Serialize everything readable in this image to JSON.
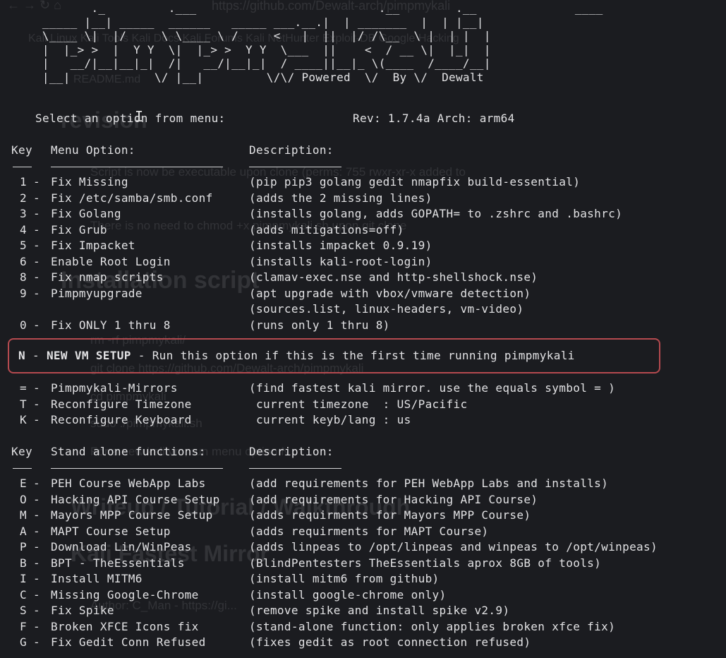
{
  "ghost": {
    "url": "https://github.com/Dewalt-arch/pimpmykali",
    "bookmarks": "Kali Linux   Kali Tools   Kali Docs   Kali Forums   Kali NetHunter   Exploit-DB   Google Hacking",
    "readme": "README.md",
    "h_revision": "revision",
    "bullet1": "Script is now be executable upon clone (perms: 755 rwxr-xr-x added to",
    "bullet2": "There is no need to chmod +x pimpmykali.sh upon git clone",
    "h_installation": "Installation script",
    "bullet3": "rm -rf pimpmykali/",
    "bullet4": "git clone https://github.com/Dewalt-arch/pimpmykali",
    "bullet5": "cd pimpmykali",
    "bullet6": "sudo ./pimpmykali.sh",
    "bullet7": "For a new kali vm, run menu option N",
    "h_writeup": "Writeup / Tutorial / Walkthrough",
    "h_fastest": "Kali Fastest Mirror",
    "bullet8": "Author: C_Man - https://gi..."
  },
  "banner": {
    "ascii": "        ._         .___                          .__        .__              ____\n _____ |__| _____  ______   _____ ___.__.|  | _______  |  | |__|  \n \\____ \\|  |/     \\ \\____ \\ /     <   |  ||  |/ /\\__  \\ |  | |  | \n |  |_> >  |  Y Y  \\|  |_> >  Y Y  \\___  ||    <  / __ \\|  |_|  | \n |   __/|__|__|_|  /|   __/|__|_|  / ____||__|_ \\(____  /____/__| \n |__|            \\/ |__|         \\/\\/ Powered  \\/  By \\/  Dewalt",
    "prompt": "Select an option from menu:",
    "rev": "Rev: 1.7.4a Arch: arm64"
  },
  "menu": {
    "key_header": "Key",
    "option_header": "Menu Option:",
    "desc_header": "Description:",
    "items": [
      {
        "key": "1",
        "label": "Fix Missing",
        "desc": "(pip pip3 golang gedit nmapfix build-essential)"
      },
      {
        "key": "2",
        "label": "Fix /etc/samba/smb.conf",
        "desc": "(adds the 2 missing lines)"
      },
      {
        "key": "3",
        "label": "Fix Golang",
        "desc": "(installs golang, adds GOPATH= to .zshrc and .bashrc)"
      },
      {
        "key": "4",
        "label": "Fix Grub",
        "desc": "(adds mitigations=off)"
      },
      {
        "key": "5",
        "label": "Fix Impacket",
        "desc": "(installs impacket 0.9.19)"
      },
      {
        "key": "6",
        "label": "Enable Root Login",
        "desc": "(installs kali-root-login)"
      },
      {
        "key": "8",
        "label": "Fix nmap scripts",
        "desc": "(clamav-exec.nse and http-shellshock.nse)"
      },
      {
        "key": "9",
        "label": "Pimpmyupgrade",
        "desc": "(apt upgrade with vbox/vmware detection)"
      },
      {
        "key": "",
        "label": "",
        "desc": "(sources.list, linux-headers, vm-video)"
      },
      {
        "key": "0",
        "label": "Fix ONLY 1 thru 8",
        "desc": "(runs only 1 thru 8)"
      }
    ],
    "new_vm": {
      "key": "N",
      "label": "NEW VM SETUP",
      "desc": "Run this option if this is the first time running pimpmykali"
    },
    "extra": [
      {
        "key": "=",
        "label": "Pimpmykali-Mirrors",
        "desc": "(find fastest kali mirror. use the equals symbol = )"
      },
      {
        "key": "T",
        "label": "Reconfigure Timezone",
        "desc": " current timezone  : US/Pacific"
      },
      {
        "key": "K",
        "label": "Reconfigure Keyboard",
        "desc": " current keyb/lang : us"
      }
    ]
  },
  "standalone": {
    "key_header": "Key",
    "option_header": "Stand alone functions:",
    "desc_header": "Description:",
    "items": [
      {
        "key": "E",
        "label": "PEH Course WebApp Labs",
        "desc": "(add requirements for PEH WebApp Labs and installs)"
      },
      {
        "key": "O",
        "label": "Hacking API Course Setup",
        "desc": "(add requirements for Hacking API Course)"
      },
      {
        "key": "M",
        "label": "Mayors MPP Course Setup",
        "desc": "(adds requirments for Mayors MPP Course)"
      },
      {
        "key": "A",
        "label": "MAPT Course Setup",
        "desc": "(adds requirments for MAPT Course)"
      },
      {
        "key": "P",
        "label": "Download Lin/WinPeas",
        "desc": "(adds linpeas to /opt/linpeas and winpeas to /opt/winpeas)"
      },
      {
        "key": "B",
        "label": "BPT - TheEssentials",
        "desc": "(BlindPentesters TheEssentials aprox 8GB of tools)"
      },
      {
        "key": "I",
        "label": "Install MITM6",
        "desc": "(install mitm6 from github)"
      },
      {
        "key": "C",
        "label": "Missing Google-Chrome",
        "desc": "(install google-chrome only)"
      },
      {
        "key": "S",
        "label": "Fix Spike",
        "desc": "(remove spike and install spike v2.9)"
      },
      {
        "key": "F",
        "label": "Broken XFCE Icons fix",
        "desc": "(stand-alone function: only applies broken xfce fix)"
      },
      {
        "key": "G",
        "label": "Fix Gedit Conn Refused",
        "desc": "(fixes gedit as root connection refused)"
      }
    ]
  }
}
